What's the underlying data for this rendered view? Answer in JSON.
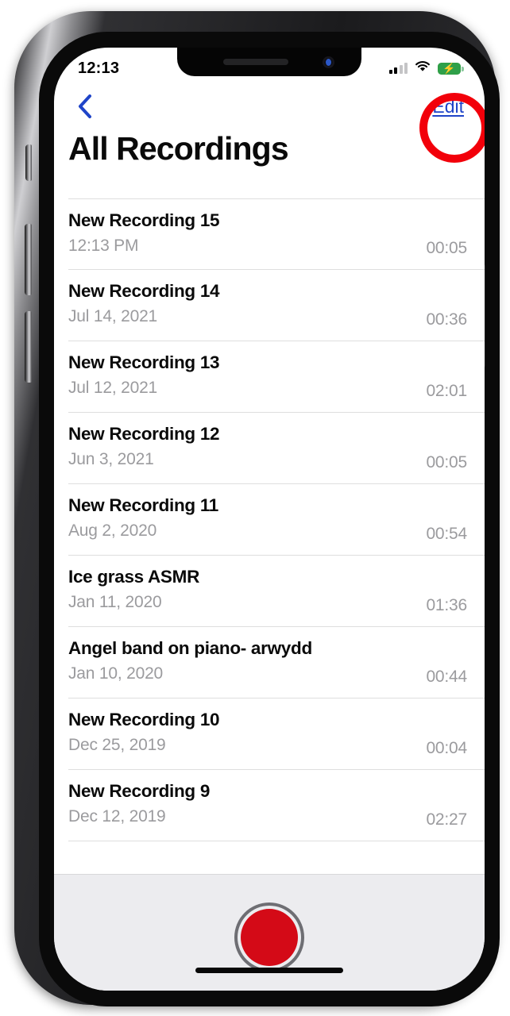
{
  "status_bar": {
    "time": "12:13",
    "cellular_icon": "cellular-bars-icon",
    "cellular_bars_filled": 2,
    "cellular_bars_total": 4,
    "wifi_icon": "wifi-icon",
    "battery_icon": "battery-charging-icon",
    "battery_charging": true,
    "battery_color": "#2fa049"
  },
  "nav_bar": {
    "back_icon": "back-chevron-icon",
    "back_color": "#1f44c8",
    "edit_label": "Edit",
    "edit_color": "#1f44c8"
  },
  "annotation": {
    "shape": "circle",
    "color": "#f2000a",
    "target": "Edit"
  },
  "header": {
    "title": "All Recordings"
  },
  "list": {
    "rows": [
      {
        "title": "New Recording 15",
        "date": "12:13 PM",
        "duration": "00:05"
      },
      {
        "title": "New Recording 14",
        "date": "Jul 14, 2021",
        "duration": "00:36"
      },
      {
        "title": "New Recording 13",
        "date": "Jul 12, 2021",
        "duration": "02:01"
      },
      {
        "title": "New Recording 12",
        "date": "Jun 3, 2021",
        "duration": "00:05"
      },
      {
        "title": "New Recording 11",
        "date": "Aug 2, 2020",
        "duration": "00:54"
      },
      {
        "title": "Ice grass ASMR",
        "date": "Jan 11, 2020",
        "duration": "01:36"
      },
      {
        "title": "Angel band on piano- arwydd",
        "date": "Jan 10, 2020",
        "duration": "00:44"
      },
      {
        "title": "New Recording 10",
        "date": "Dec 25, 2019",
        "duration": "00:04"
      },
      {
        "title": "New Recording 9",
        "date": "Dec 12, 2019",
        "duration": "02:27"
      }
    ]
  },
  "toolbar": {
    "record_button_icon": "record-circle-icon",
    "record_button_color": "#d40a17",
    "home_indicator_icon": "home-indicator"
  }
}
